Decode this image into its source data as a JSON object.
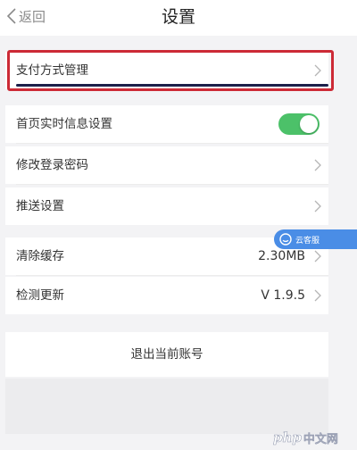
{
  "nav": {
    "back_label": "返回",
    "title": "设置"
  },
  "settings": {
    "payment": {
      "label": "支付方式管理"
    },
    "realtime_info": {
      "label": "首页实时信息设置",
      "enabled": true
    },
    "change_password": {
      "label": "修改登录密码"
    },
    "push": {
      "label": "推送设置"
    },
    "clear_cache": {
      "label": "清除缓存",
      "value": "2.30MB"
    },
    "check_update": {
      "label": "检测更新",
      "value": "V 1.9.5"
    }
  },
  "logout": {
    "label": "退出当前账号"
  },
  "float_badge": {
    "label": "云客服"
  },
  "watermark": {
    "logo": "php",
    "text": "中文网"
  },
  "colors": {
    "toggle_on": "#4cc169",
    "highlight": "#cc2a36",
    "badge": "#4a8de6",
    "background": "#f3f3f5"
  }
}
